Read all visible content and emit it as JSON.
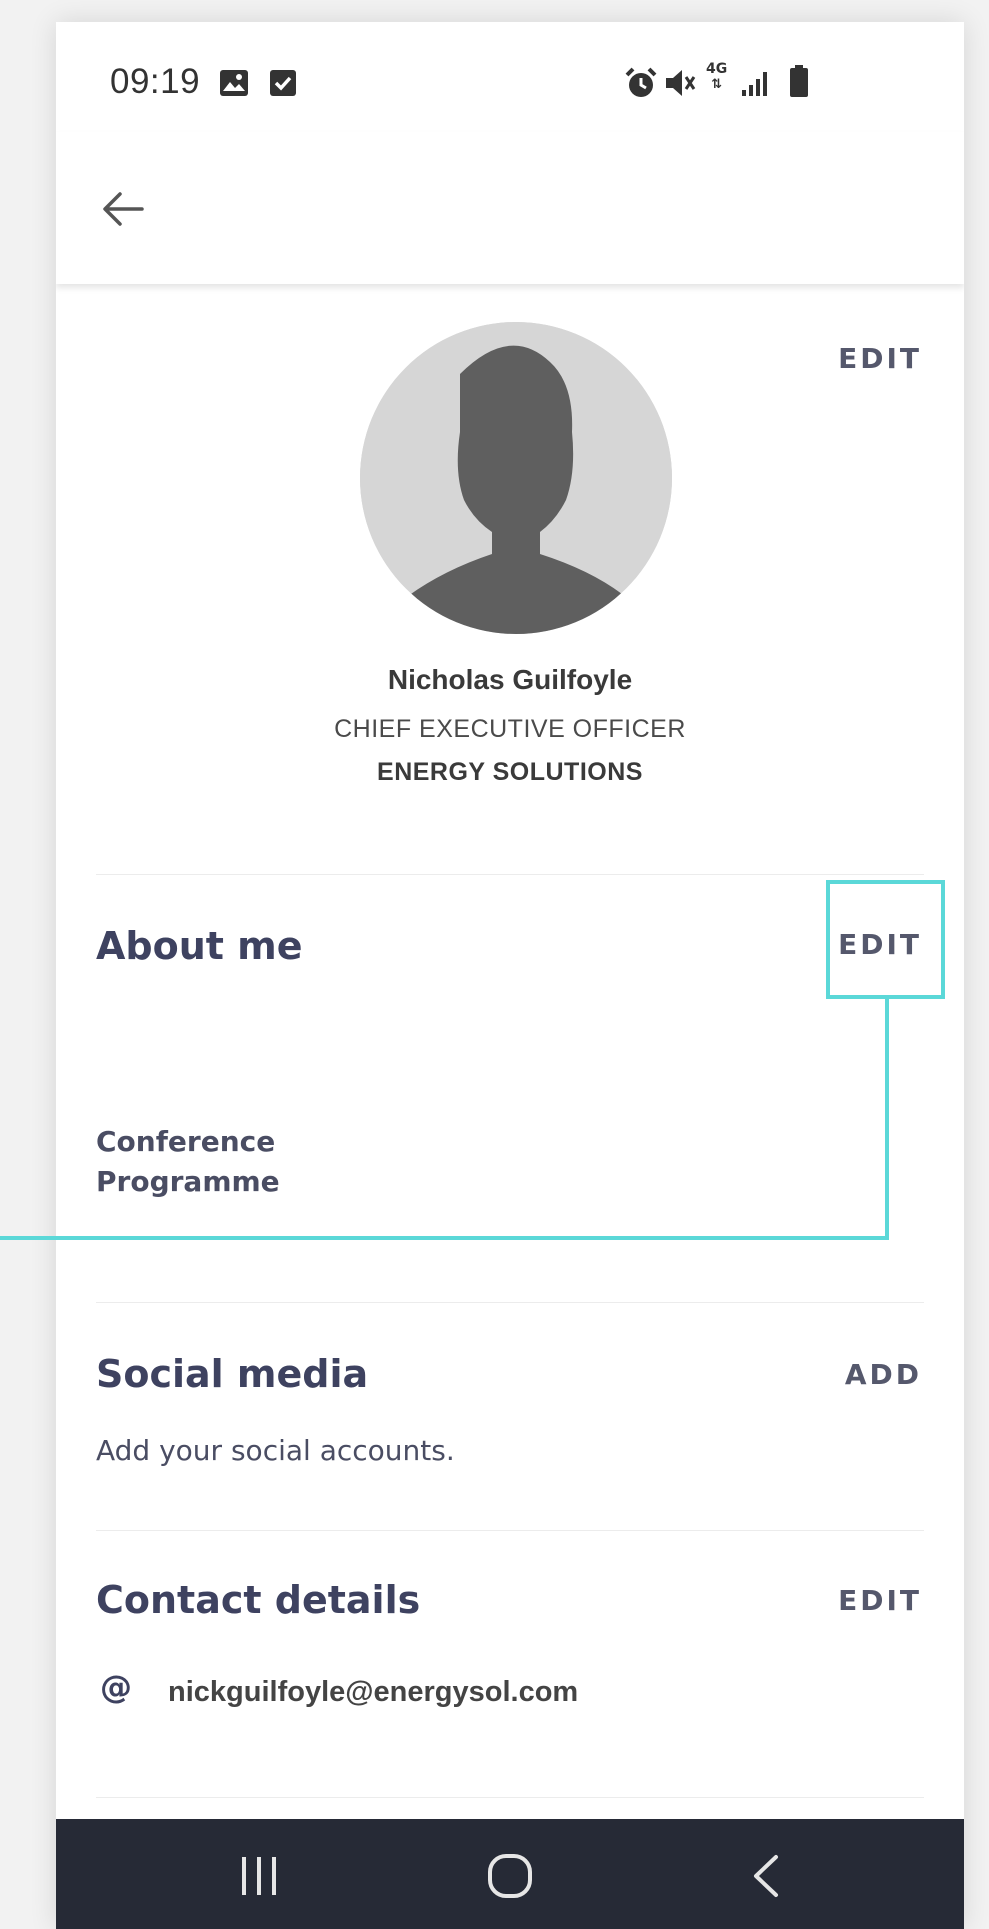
{
  "status_bar": {
    "time": "09:19",
    "left_icons": [
      "image-icon",
      "checkbox-icon"
    ],
    "right_icons": [
      "alarm-icon",
      "mute-icon",
      "4g-icon",
      "signal-icon",
      "battery-icon"
    ],
    "network_label": "4G"
  },
  "header": {
    "back_icon": "arrow-left-icon"
  },
  "profile": {
    "edit_label": "EDIT",
    "name": "Nicholas Guilfoyle",
    "job_title": "CHIEF EXECUTIVE OFFICER",
    "company": "ENERGY SOLUTIONS"
  },
  "about": {
    "title": "About me",
    "edit_label": "EDIT",
    "body": "Conference\nProgramme"
  },
  "social": {
    "title": "Social media",
    "add_label": "ADD",
    "body": "Add your social accounts."
  },
  "contact": {
    "title": "Contact details",
    "edit_label": "EDIT",
    "email_icon": "at-icon",
    "email": "nickguilfoyle@energysol.com"
  },
  "navbar": {
    "buttons": [
      "recents-icon",
      "home-icon",
      "back-icon"
    ]
  },
  "colors": {
    "accent_highlight": "#5bd8d8",
    "title_text": "#3e4260",
    "navbar_bg": "#262a36"
  }
}
